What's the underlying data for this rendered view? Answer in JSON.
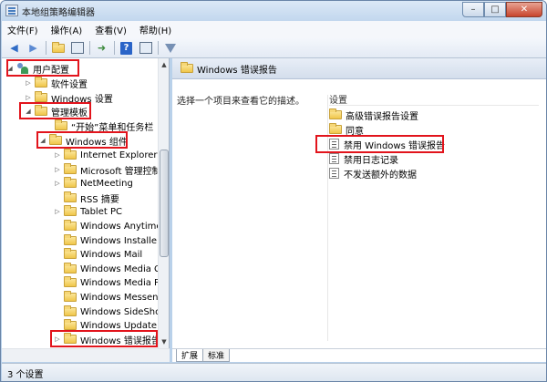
{
  "window": {
    "title": "本地组策略编辑器",
    "controls": {
      "minimize": "–",
      "maximize": "□",
      "close": "✕"
    }
  },
  "menu": [
    "文件(F)",
    "操作(A)",
    "查看(V)",
    "帮助(H)"
  ],
  "toolbar": [
    "back-arrow",
    "forward-arrow",
    "up-folder",
    "show-hide-tree",
    "export-list",
    "help",
    "properties",
    "filter"
  ],
  "tree": {
    "user_config": "用户配置",
    "software_settings": "软件设置",
    "windows_settings": "Windows 设置",
    "admin_templates": "管理模板",
    "start_menu": "“开始”菜单和任务栏",
    "windows_components": "Windows 组件",
    "components": [
      "Internet Explorer",
      "Microsoft 管理控制台",
      "NetMeeting",
      "RSS 摘要",
      "Tablet PC",
      "Windows Anytime Upgrade",
      "Windows Installer",
      "Windows Mail",
      "Windows Media Center",
      "Windows Media Player",
      "Windows Messenger",
      "Windows SideShow",
      "Windows Update",
      "Windows 错误报告"
    ]
  },
  "right_pane": {
    "header": "Windows 错误报告",
    "description": "选择一个项目来查看它的描述。",
    "column_header": "设置",
    "items": [
      {
        "label": "高级错误报告设置",
        "icon": "folder-icon"
      },
      {
        "label": "同意",
        "icon": "folder-icon"
      },
      {
        "label": "禁用 Windows 错误报告",
        "icon": "setting-icon"
      },
      {
        "label": "禁用日志记录",
        "icon": "setting-icon"
      },
      {
        "label": "不发送额外的数据",
        "icon": "setting-icon"
      }
    ]
  },
  "tabs": {
    "extended": "扩展",
    "standard": "标准"
  },
  "status": {
    "text": "3 个设置"
  },
  "colors": {
    "highlight": "#e2141c",
    "title_bg": "#c2d7ee",
    "folder": "#f0c64a"
  }
}
